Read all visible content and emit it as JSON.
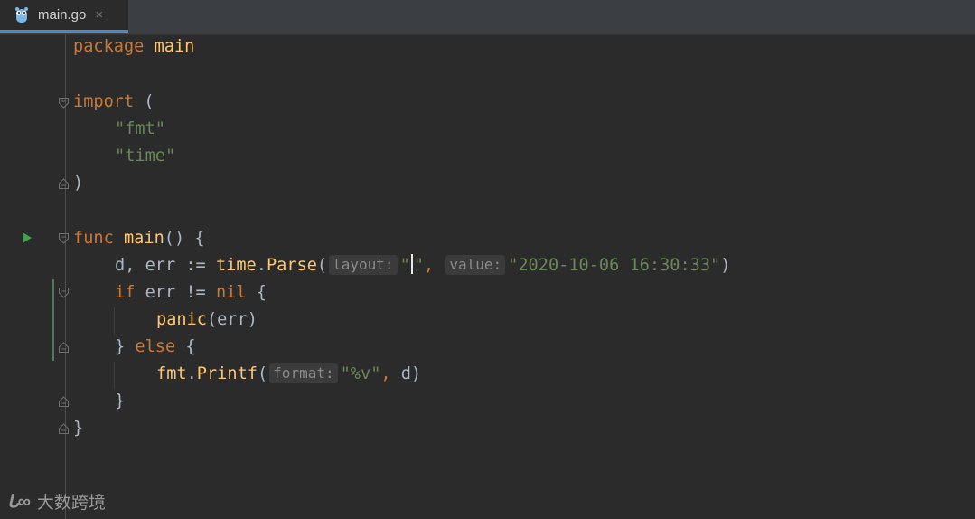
{
  "tab": {
    "filename": "main.go",
    "close_glyph": "×",
    "icon": "gopher-icon"
  },
  "code": {
    "line1": {
      "kw": "package",
      "name": "main"
    },
    "line3": {
      "kw": "import",
      "paren": "("
    },
    "line4": {
      "str": "\"fmt\""
    },
    "line5": {
      "str": "\"time\""
    },
    "line6": {
      "paren": ")"
    },
    "line8": {
      "kw": "func",
      "fn": "main",
      "rest": "() {"
    },
    "line9": {
      "pre": "d, err := ",
      "pkg": "time",
      "dot": ".",
      "fn": "Parse",
      "open": "(",
      "hint1": "layout:",
      "str1_open": "\"",
      "str1_close": "\"",
      "comma": ",",
      "hint2": "value:",
      "str2": "\"2020-10-06 16:30:33\"",
      "close": ")"
    },
    "line10": {
      "kw": "if",
      "mid": " err != ",
      "nil": "nil",
      "rest": " {"
    },
    "line11": {
      "fn": "panic",
      "rest": "(err)"
    },
    "line12": {
      "pre": "} ",
      "kw": "else",
      "rest": " {"
    },
    "line13": {
      "pkg": "fmt",
      "dot": ".",
      "fn": "Printf",
      "open": "(",
      "hint": "format:",
      "str": "\"%v\"",
      "comma": ",",
      "rest": " d)"
    },
    "line14": {
      "text": "}"
    },
    "line15": {
      "text": "}"
    }
  },
  "watermark": {
    "mark": "ᒐ∞",
    "text": "大数跨境"
  },
  "colors": {
    "background": "#2b2b2b",
    "keyword": "#cc7832",
    "function": "#ffc66d",
    "string": "#6a8759",
    "plain": "#a9b7c6",
    "tab_underline": "#4a88c7",
    "run_icon": "#3ea54a"
  }
}
